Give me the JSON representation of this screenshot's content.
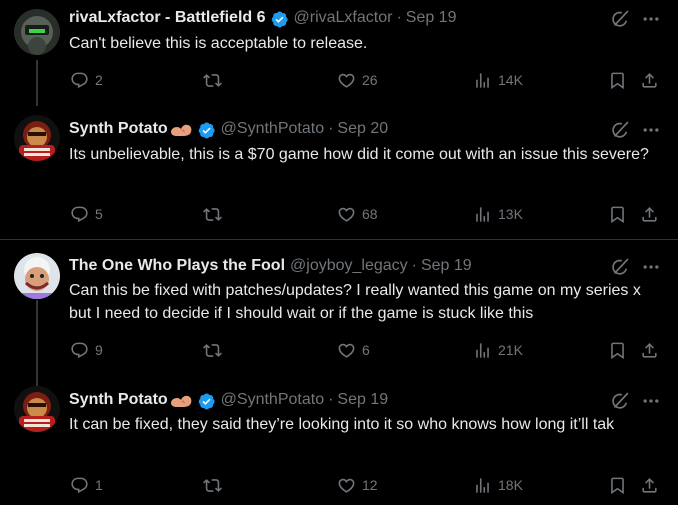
{
  "colors": {
    "background": "#000000",
    "primary_text": "#e7e9ea",
    "secondary_text": "#71767b",
    "verified_blue": "#1d9bf0",
    "divider": "#2f3336"
  },
  "tweets": [
    {
      "display_name": "rivaLxfactor - Battlefield 6",
      "verified": true,
      "handle": "@rivaLxfactor",
      "separator": "·",
      "date": "Sep 19",
      "text": "Can't believe this is acceptable to release.",
      "replies": "2",
      "retweets": "",
      "likes": "26",
      "views": "14K"
    },
    {
      "display_name": "Synth Potato",
      "verified": true,
      "handle": "@SynthPotato",
      "separator": "·",
      "date": "Sep 20",
      "text": "Its unbelievable, this is a $70 game how did it come out with an issue this severe?",
      "replies": "5",
      "retweets": "",
      "likes": "68",
      "views": "13K"
    },
    {
      "display_name": "The One Who Plays the Fool",
      "verified": false,
      "handle": "@joyboy_legacy",
      "separator": "·",
      "date": "Sep 19",
      "text": "Can this be fixed with patches/updates? I really wanted this game on my series x but I need to decide if I should wait or if the game is stuck like this",
      "replies": "9",
      "retweets": "",
      "likes": "6",
      "views": "21K"
    },
    {
      "display_name": "Synth Potato",
      "verified": true,
      "handle": "@SynthPotato",
      "separator": "·",
      "date": "Sep 19",
      "text": "It can be fixed, they said they’re looking into it so who knows how long it’ll tak",
      "replies": "1",
      "retweets": "",
      "likes": "12",
      "views": "18K"
    }
  ],
  "icons": {
    "reply": "reply-bubble-icon",
    "retweet": "retweet-icon",
    "like": "heart-icon",
    "views": "views-bar-chart-icon",
    "bookmark": "bookmark-icon",
    "share": "share-icon",
    "grok": "grok-icon",
    "more": "more-dots-icon",
    "verified": "verified-badge-icon",
    "name_emoji": "flexed-arm-emoji-icon"
  }
}
